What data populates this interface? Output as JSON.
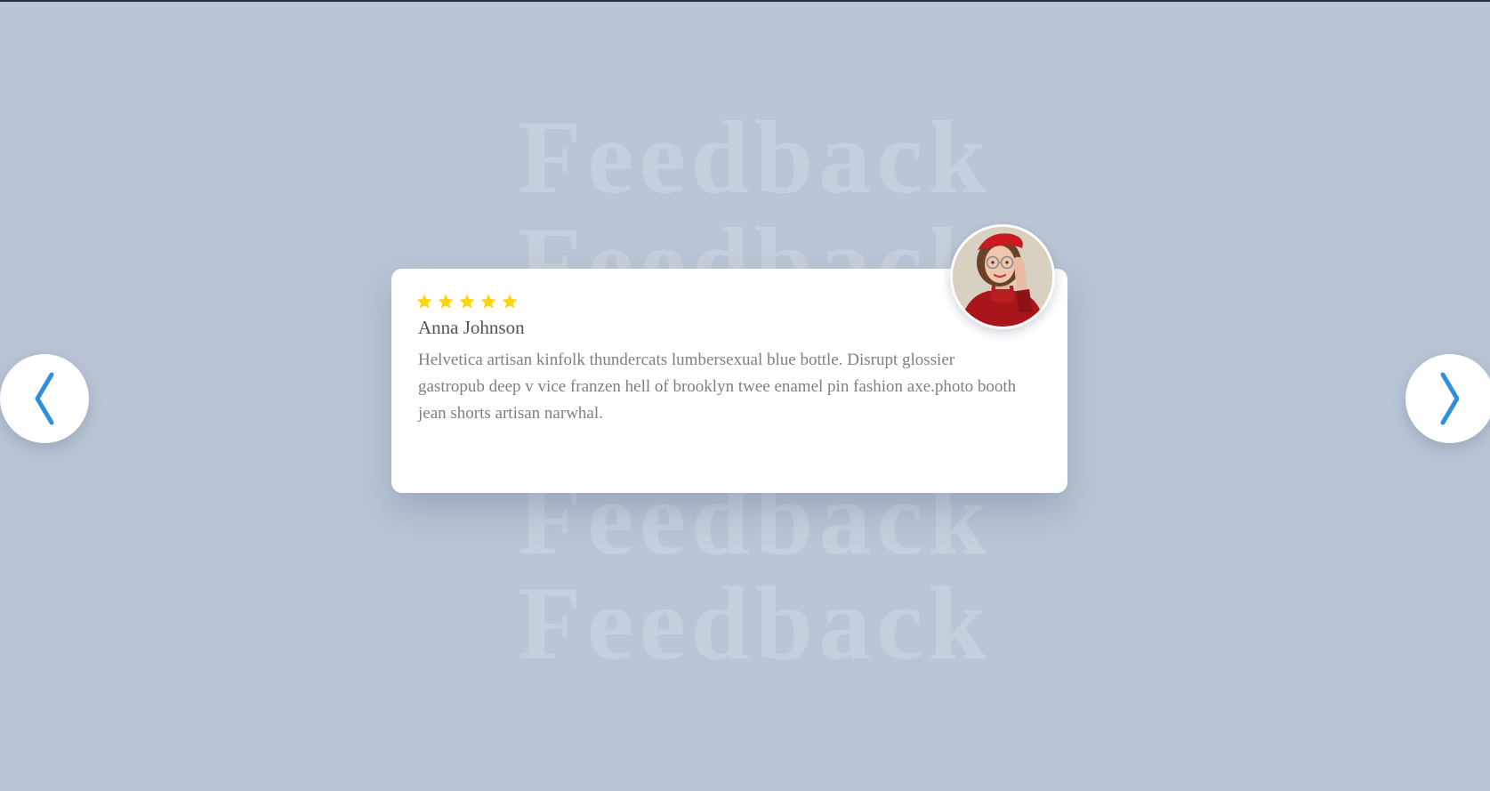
{
  "background": {
    "watermark_words": [
      "Feedback",
      "Feedback",
      "Feedback",
      "Feedback"
    ],
    "color": "#bac6d5"
  },
  "navigation": {
    "prev_icon": "chevron-left-icon",
    "next_icon": "chevron-right-icon",
    "accent_color": "#2f8fd8"
  },
  "testimonial": {
    "rating": 5,
    "max_rating": 5,
    "star_color": "#ffd400",
    "name": "Anna Johnson",
    "text": "Helvetica artisan kinfolk thundercats lumbersexual blue bottle. Disrupt glossier gastropub deep v vice franzen hell of brooklyn twee enamel pin fashion axe.photo booth jean shorts artisan narwhal.",
    "avatar_icon": "avatar-photo"
  }
}
